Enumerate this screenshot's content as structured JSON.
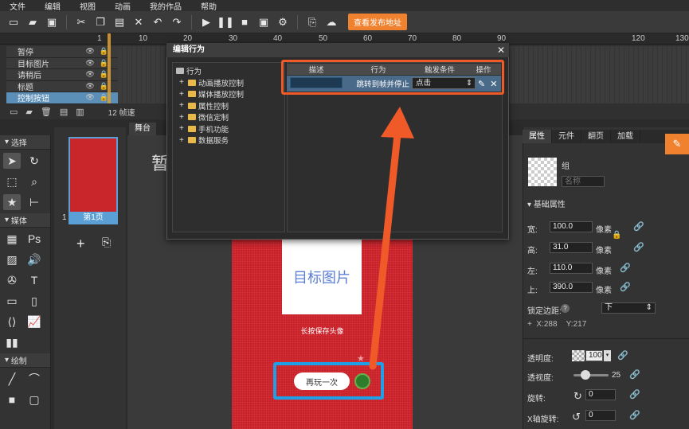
{
  "menu": [
    "文件",
    "编辑",
    "视图",
    "动画",
    "我的作品",
    "帮助"
  ],
  "toolbar": {
    "publish_label": "查看发布地址"
  },
  "timeline": {
    "ruler": [
      "1",
      "10",
      "20",
      "30",
      "40",
      "50",
      "60",
      "70",
      "80",
      "90",
      "120",
      "130"
    ],
    "layers": [
      {
        "name": "暂停",
        "selected": false
      },
      {
        "name": "目标图片",
        "selected": false
      },
      {
        "name": "请稍后",
        "selected": false
      },
      {
        "name": "标题",
        "selected": false
      },
      {
        "name": "控制按钮",
        "selected": true
      }
    ],
    "fps_label": "12 帧速"
  },
  "tools": {
    "select_head": "选择",
    "media_head": "媒体",
    "draw_head": "绘制"
  },
  "pages": {
    "page_label": "第1页",
    "page_num": "1"
  },
  "stage": {
    "tab": "舞台",
    "partial_char": "暂",
    "target_image_text": "目标图片",
    "save_text": "长按保存头像",
    "replay_button": "再玩一次"
  },
  "dialog": {
    "title": "编辑行为",
    "tree_root": "行为",
    "tree_items": [
      "动画播放控制",
      "媒体播放控制",
      "属性控制",
      "微信定制",
      "手机功能",
      "数据服务"
    ],
    "columns": {
      "desc": "描述",
      "action": "行为",
      "trigger": "触发条件",
      "ops": "操作"
    },
    "rule": {
      "action": "跳转到帧并停止",
      "trigger": "点击"
    }
  },
  "props": {
    "tabs": [
      "属性",
      "元件",
      "翻页",
      "加载"
    ],
    "group_label": "组",
    "name_placeholder": "名称",
    "section": "基础属性",
    "width_label": "宽:",
    "width_val": "100.0",
    "height_label": "高:",
    "height_val": "31.0",
    "left_label": "左:",
    "left_val": "110.0",
    "top_label": "上:",
    "top_val": "390.0",
    "unit": "像素",
    "anchor_label": "锁定边距:",
    "anchor_val": "下",
    "x_label": "X:288",
    "y_label": "Y:217",
    "opacity_label": "透明度:",
    "opacity_val": "100",
    "perspective_label": "透视度:",
    "perspective_val": "25",
    "rotate_label": "旋转:",
    "rotate_val": "0",
    "xrotate_label": "X轴旋转:",
    "xrotate_val": "0"
  },
  "colors": {
    "accent": "#f0822f",
    "highlight_blue": "#1ea0e8",
    "highlight_orange": "#f05a28",
    "canvas_red": "#c7222a"
  }
}
